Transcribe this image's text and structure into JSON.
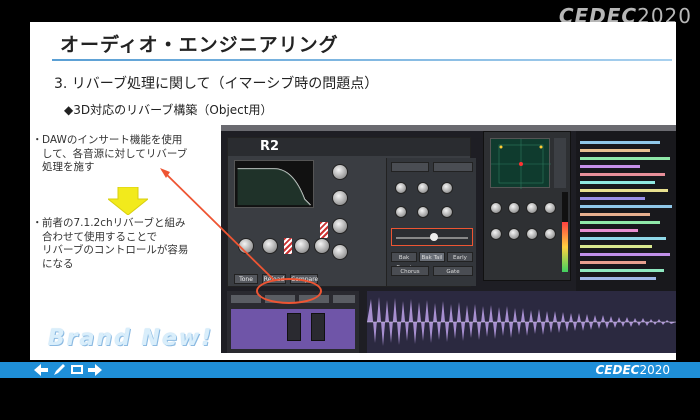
{
  "header_logo": {
    "brand": "CEDEC",
    "year": "2020"
  },
  "slide": {
    "title": "オーディオ・エンジニアリング",
    "section": "3. リバーブ処理に関して（イマーシブ時の問題点）",
    "subsection": "◆3D対応のリバーブ構築（Object用）",
    "bullets": [
      {
        "dot": "・",
        "lines": [
          "DAWのインサート機能を使用",
          "して、各音源に対してリバーブ",
          "処理を施す"
        ]
      },
      {
        "dot": "・",
        "lines": [
          "前者の7.1.2chリバーブと組み",
          "合わせて使用することで",
          "リバーブのコントロールが容易",
          "になる"
        ]
      }
    ],
    "brand_watermark": "Brand New!",
    "plugin": {
      "name": "R2",
      "buttons": [
        "Tone",
        "Reload",
        "Compare"
      ],
      "right_buttons": [
        "Bak Reset",
        "Bak Tail",
        "Early",
        "Chorus",
        "Gate"
      ]
    }
  },
  "taskbar": {
    "icons": [
      "arrow-left-icon",
      "pen-icon",
      "screen-icon",
      "arrow-right-icon"
    ],
    "logo_brand": "CEDEC",
    "logo_year": "2020"
  },
  "colors": {
    "title_rule": "#5a9fd4",
    "taskbar": "#1f8fd8",
    "arrow_yellow": "#f2ea1c",
    "annotation_red": "#ee5533",
    "waveform": "#b59ae0"
  }
}
